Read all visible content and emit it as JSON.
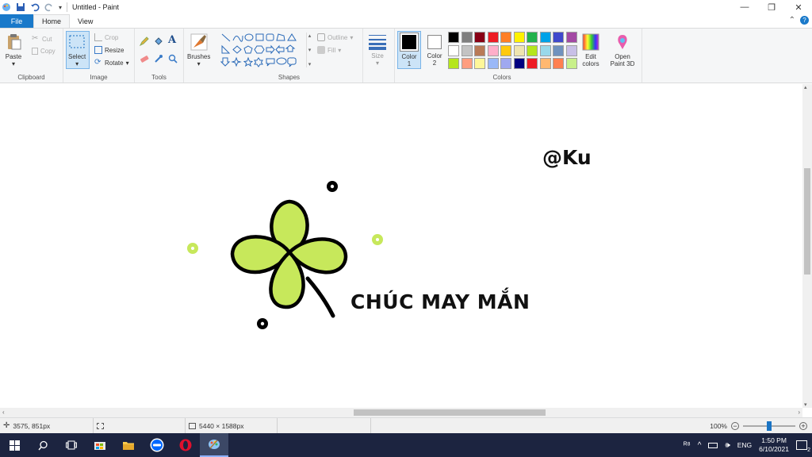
{
  "window": {
    "title": "Untitled - Paint"
  },
  "tabs": [
    {
      "label": "File"
    },
    {
      "label": "Home"
    },
    {
      "label": "View"
    }
  ],
  "ribbon": {
    "clipboard": {
      "label": "Clipboard",
      "paste": "Paste",
      "cut": "Cut",
      "copy": "Copy"
    },
    "image": {
      "label": "Image",
      "select": "Select",
      "crop": "Crop",
      "resize": "Resize",
      "rotate": "Rotate"
    },
    "tools": {
      "label": "Tools"
    },
    "brushes": {
      "label": "Brushes"
    },
    "shapes": {
      "label": "Shapes",
      "outline": "Outline",
      "fill": "Fill"
    },
    "size": {
      "label": "Size"
    },
    "colors": {
      "label": "Colors",
      "color1": "Color 1",
      "color2": "Color 2",
      "edit_colors": "Edit colors",
      "open_paint3d": "Open Paint 3D",
      "color1_value": "#000000",
      "color2_value": "#ffffff",
      "swatches": [
        "#000000",
        "#7f7f7f",
        "#880015",
        "#ed1c24",
        "#ff7f27",
        "#fff200",
        "#22b14c",
        "#00a2e8",
        "#3f48cc",
        "#a349a4",
        "#ffffff",
        "#c3c3c3",
        "#b97a57",
        "#ffaec9",
        "#ffc90e",
        "#efe4b0",
        "#b5e61d",
        "#99d9ea",
        "#7092be",
        "#c8bfe7",
        "#b5e61d",
        "#ff9e80",
        "#fff799",
        "#9ab8f7",
        "#9fa8f0",
        "#000080",
        "#ed1c24",
        "#ffb870",
        "#ff7f50",
        "#c8f08a"
      ]
    }
  },
  "canvas": {
    "signature": "@Ku",
    "greeting": "CHÚC MAY MẮN",
    "clover_color": "#c7e85b"
  },
  "status": {
    "cursor_pos": "3575, 851px",
    "image_size": "5440 × 1588px",
    "zoom": "100%",
    "zoom_fraction": 0.5
  },
  "taskbar": {
    "apps": [
      "windows-icon",
      "search-icon",
      "task-view-icon",
      "store-icon",
      "explorer-icon",
      "zalo-icon",
      "opera-icon",
      "paint-icon"
    ],
    "lang": "ENG",
    "time": "1:50 PM",
    "date": "6/10/2021",
    "notifications": "2"
  }
}
